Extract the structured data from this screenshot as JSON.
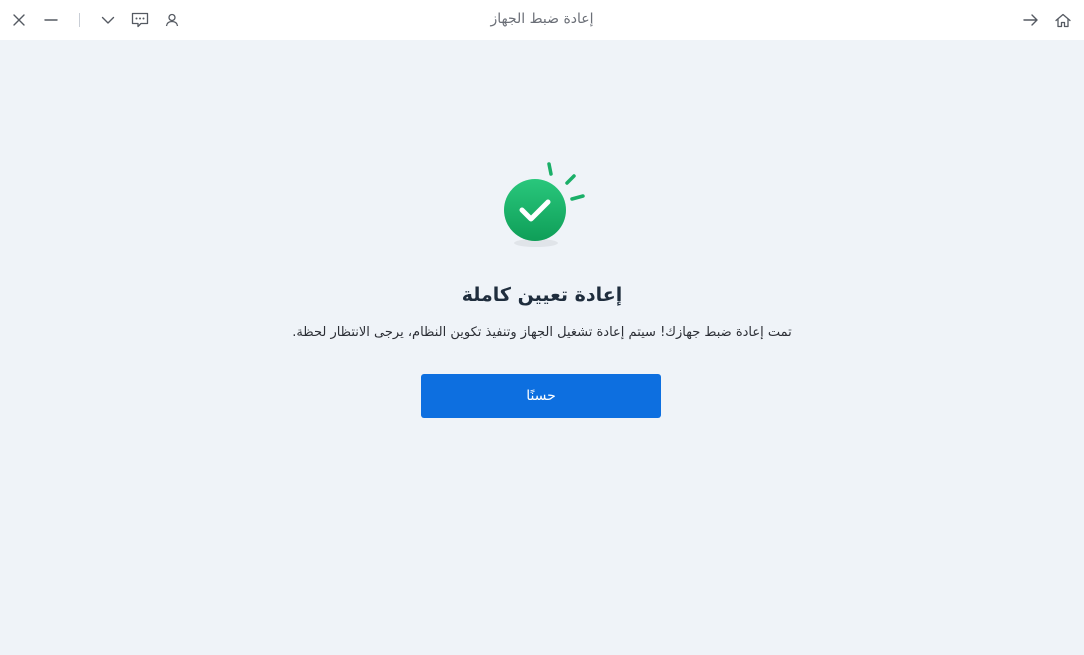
{
  "window": {
    "title": "إعادة ضبط الجهاز",
    "controls": [
      "close-icon",
      "minimize-icon",
      "chevron-down-icon",
      "feedback-icon",
      "user-icon"
    ],
    "nav": [
      "arrow-right-icon",
      "home-icon"
    ]
  },
  "result": {
    "icon": "check-circle-icon",
    "heading": "إعادة تعيين كاملة",
    "message": "تمت إعادة ضبط جهازك! سيتم إعادة تشغيل الجهاز وتنفيذ تكوين النظام، يرجى الانتظار لحظة.",
    "ok_label": "حسنًا"
  },
  "colors": {
    "background": "#eff3f8",
    "accent": "#0d6fe0",
    "success": "#17b26a"
  }
}
